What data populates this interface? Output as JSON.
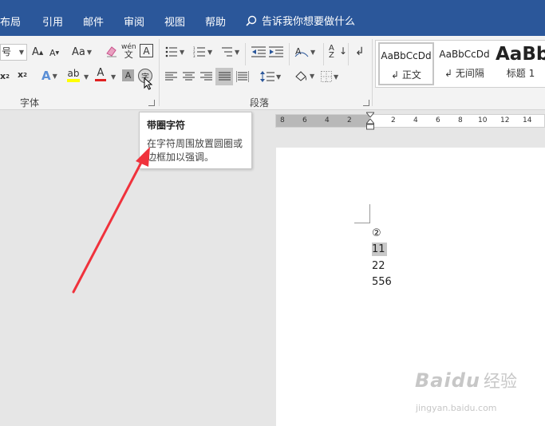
{
  "tabs": [
    {
      "label": "布局"
    },
    {
      "label": "引用"
    },
    {
      "label": "邮件"
    },
    {
      "label": "审阅"
    },
    {
      "label": "视图"
    },
    {
      "label": "帮助"
    }
  ],
  "tell_me": {
    "icon": "search-icon",
    "text": "告诉我你想要做什么"
  },
  "ribbon": {
    "font_group": {
      "label": "字体",
      "font_size_value": "号",
      "change_case_label": "Aa",
      "phonetic_top": "wén",
      "phonetic_bottom": "文"
    },
    "paragraph_group": {
      "label": "段落"
    },
    "styles": [
      {
        "sample": "AaBbCcDd",
        "name": "正文",
        "prefix": "↲ "
      },
      {
        "sample": "AaBbCcDd",
        "name": "无间隔",
        "prefix": "↲ "
      },
      {
        "sample": "AaBb",
        "name": "标题 1",
        "prefix": ""
      }
    ]
  },
  "tooltip": {
    "title": "带圈字符",
    "body_line1": "在字符周围放置圆圈或",
    "body_line2": "边框加以强调。"
  },
  "ruler": {
    "labels": [
      "8",
      "6",
      "4",
      "2",
      "2",
      "4",
      "6",
      "8",
      "10",
      "12",
      "14"
    ]
  },
  "document": {
    "lines": [
      "②",
      "11",
      "22",
      "556"
    ]
  },
  "watermark": {
    "logo": "Baidu",
    "sub": "经验",
    "url": "jingyan.baidu.com"
  },
  "colors": {
    "title_bar": "#2b579a",
    "arrow": "#f0323c",
    "highlight_yellow": "#ffff00",
    "font_red": "#e02020"
  }
}
